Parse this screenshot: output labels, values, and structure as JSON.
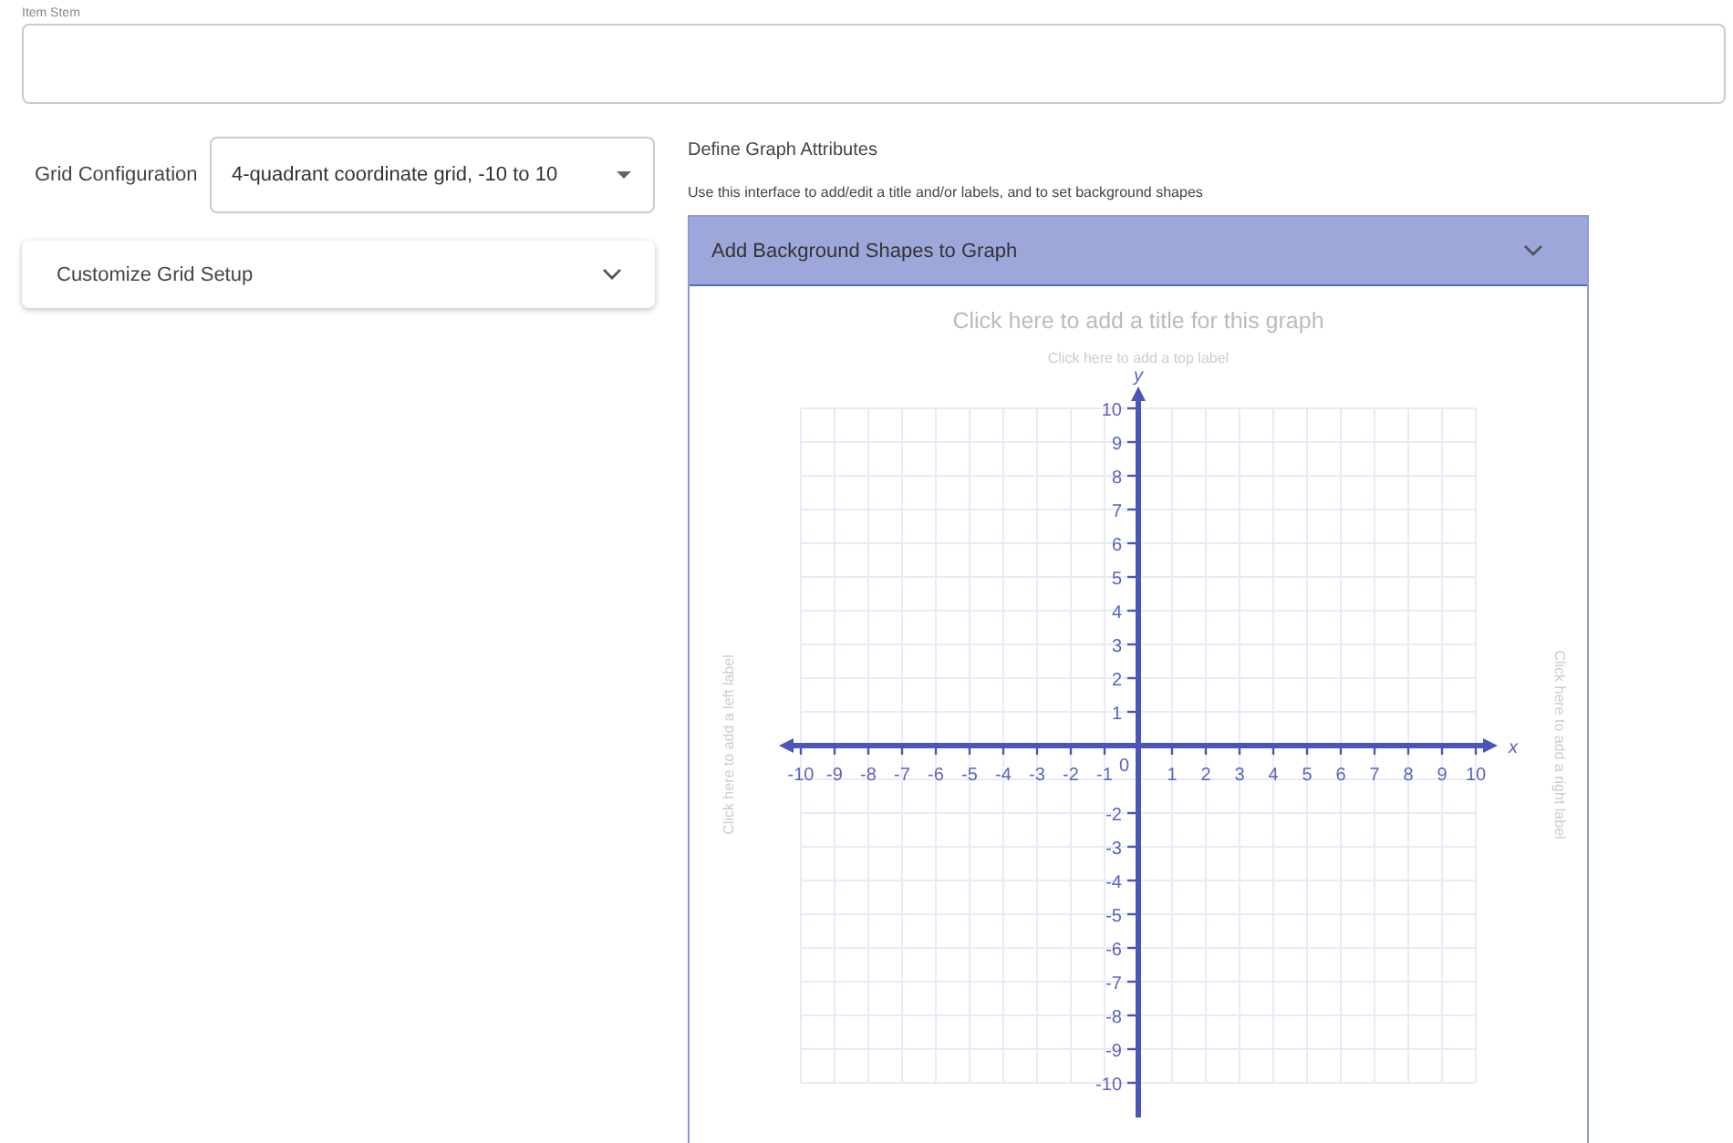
{
  "item_stem": {
    "label": "Item Stem"
  },
  "grid_configuration": {
    "label": "Grid Configuration",
    "value": "4-quadrant coordinate grid, -10 to 10"
  },
  "customize_panel": {
    "title": "Customize Grid Setup",
    "expanded": false
  },
  "graph_attributes": {
    "heading": "Define Graph Attributes",
    "description": "Use this interface to add/edit a title and/or labels, and to set background shapes",
    "background_shapes": {
      "title": "Add Background Shapes to Graph",
      "expanded": false
    },
    "graph": {
      "title_placeholder": "Click here to add a title for this graph",
      "top_label_placeholder": "Click here to add a top label",
      "left_label_placeholder": "Click here to add a left label",
      "right_label_placeholder": "Click here to add a right label",
      "x_axis": "x",
      "y_axis": "y",
      "origin": "0",
      "x_ticks_negative": [
        "-10",
        "-9",
        "-8",
        "-7",
        "-6",
        "-5",
        "-4",
        "-3",
        "-2",
        "-1"
      ],
      "x_ticks_positive": [
        "1",
        "2",
        "3",
        "4",
        "5",
        "6",
        "7",
        "8",
        "9",
        "10"
      ],
      "y_ticks_positive": [
        "10",
        "9",
        "8",
        "7",
        "6",
        "5",
        "4",
        "3",
        "2",
        "1"
      ],
      "y_ticks_negative_from_minus_two": [
        "-2",
        "-3",
        "-4",
        "-5",
        "-6",
        "-7",
        "-8",
        "-9",
        "-10"
      ]
    }
  }
}
